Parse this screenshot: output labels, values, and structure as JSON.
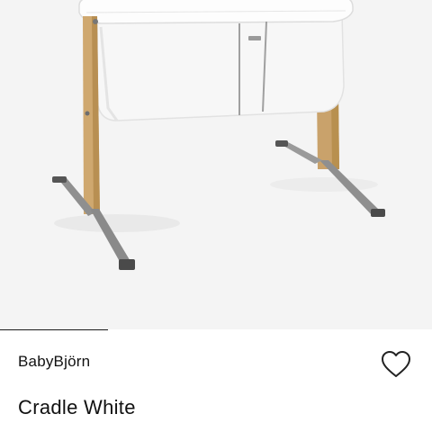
{
  "product": {
    "brand": "BabyBjörn",
    "title": "Cradle White"
  },
  "icons": {
    "wishlist": "heart-outline-icon"
  },
  "colors": {
    "image_background": "#f4f4f4",
    "text": "#111111",
    "cradle_fabric": "#f7f7f7",
    "wood": "#c9a26b",
    "metal": "#8f8f8f"
  }
}
